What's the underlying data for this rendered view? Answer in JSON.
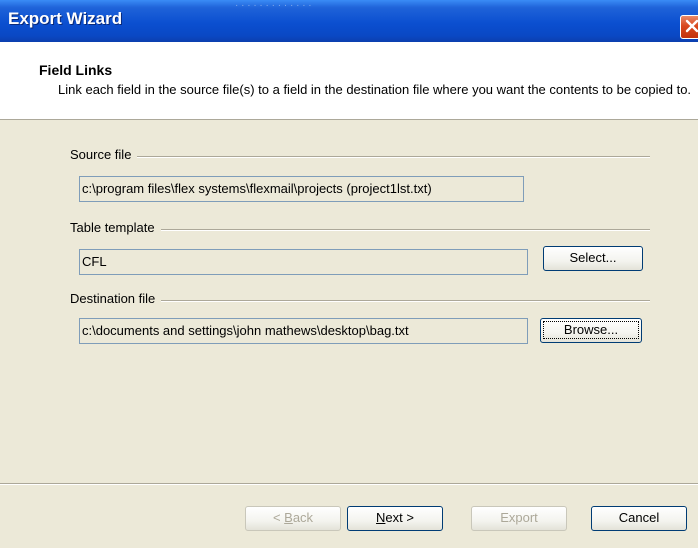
{
  "window": {
    "title": "Export Wizard",
    "faint_top_text": "· · · · · · · · · · · · ·"
  },
  "header": {
    "title": "Field Links",
    "description": "Link each field in the source file(s) to a field in the destination file where you want the contents to be copied to."
  },
  "source": {
    "label": "Source file",
    "value": "c:\\program files\\flex systems\\flexmail\\projects (project1lst.txt)"
  },
  "template": {
    "label": "Table template",
    "value": "CFL",
    "select_label": "Select..."
  },
  "destination": {
    "label": "Destination file",
    "value": "c:\\documents and settings\\john mathews\\desktop\\bag.txt",
    "browse_label": "Browse..."
  },
  "buttons": {
    "back_prefix": "< ",
    "back_accel": "B",
    "back_rest": "ack",
    "next_accel": "N",
    "next_rest": "ext >",
    "export": "Export",
    "cancel": "Cancel"
  }
}
